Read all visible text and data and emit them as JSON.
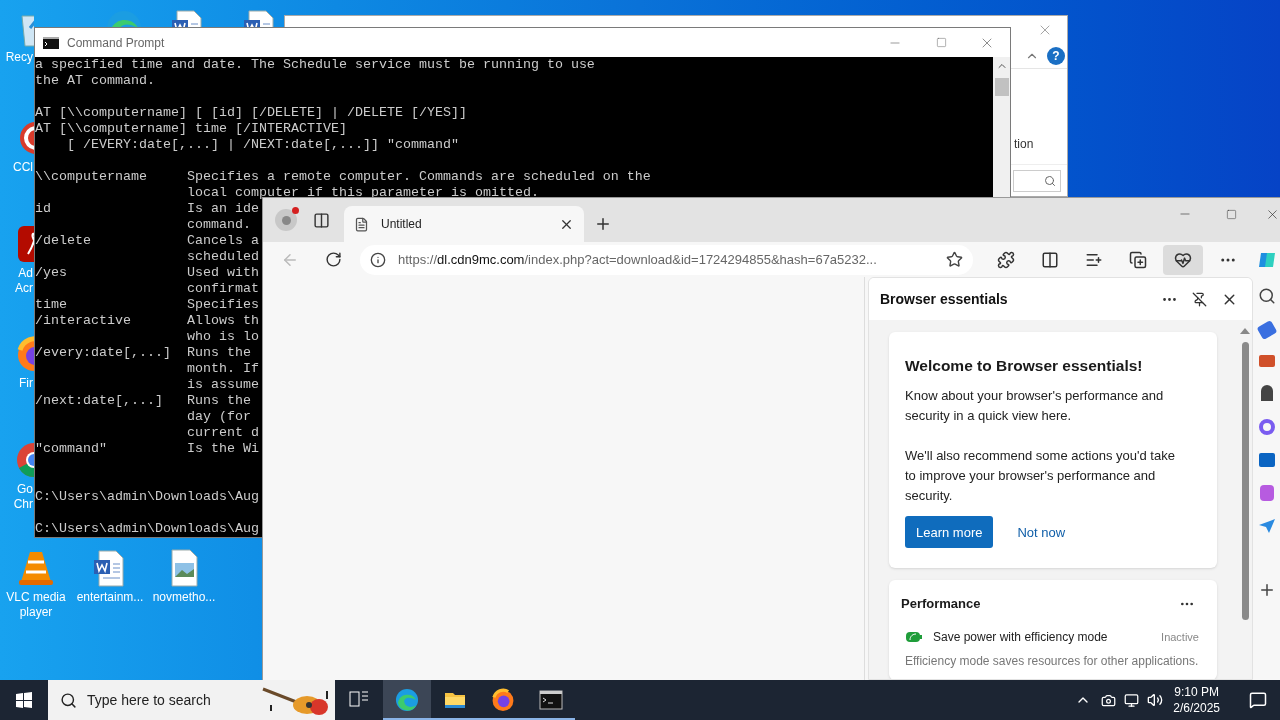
{
  "desktop_icons": [
    {
      "kind": "recycle",
      "lines": [
        "Recy"
      ]
    },
    {
      "kind": "edge"
    },
    {
      "kind": "word"
    },
    {
      "kind": "word"
    },
    {
      "kind": "ccleaner",
      "lines": [
        "CCl"
      ]
    },
    {
      "kind": "acrobat",
      "lines": [
        "Ad",
        "Acr"
      ]
    },
    {
      "kind": "firefox",
      "lines": [
        "Fir"
      ]
    },
    {
      "kind": "chrome",
      "lines": [
        "Go",
        "Chr"
      ]
    },
    {
      "kind": "vlc",
      "lines": [
        "VLC media",
        "player"
      ]
    },
    {
      "kind": "word",
      "lines": [
        "entertainm..."
      ]
    },
    {
      "kind": "image",
      "lines": [
        "novmetho..."
      ]
    }
  ],
  "explorer": {
    "fragments": [
      "tion"
    ],
    "help": "?"
  },
  "cmd": {
    "title": "Command Prompt",
    "blocks": [
      {
        "kind": "help",
        "lines": [
          "a specified time and date. The Schedule service must be running to use",
          "the AT command."
        ]
      },
      {
        "kind": "help",
        "lines": [
          "AT [\\\\computername] [ [id] [/DELETE] | /DELETE [/YES]]",
          "AT [\\\\computername] time [/INTERACTIVE]",
          "    [ /EVERY:date[,...] | /NEXT:date[,...]] \"command\""
        ]
      },
      {
        "kind": "help",
        "lines": [
          "\\\\computername     Specifies a remote computer. Commands are scheduled on the",
          "                   local computer if this parameter is omitted.",
          "id                 Is an ide",
          "                   command.",
          "/delete            Cancels a",
          "                   scheduled",
          "/yes               Used with",
          "                   confirmat",
          "time               Specifies",
          "/interactive       Allows th",
          "                   who is lo",
          "/every:date[,...]  Runs the",
          "                   month. If",
          "                   is assume",
          "/next:date[,...]   Runs the",
          "                   day (for",
          "                   current d",
          "\"command\"          Is the Wi"
        ]
      },
      {
        "kind": "prompt",
        "lines": [
          "C:\\Users\\admin\\Downloads\\Aug"
        ]
      },
      {
        "kind": "prompt",
        "lines": [
          "C:\\Users\\admin\\Downloads\\Aug"
        ]
      }
    ]
  },
  "browser": {
    "tabs": [
      {
        "title": "Untitled",
        "selected": true
      }
    ],
    "url": {
      "scheme": "https://",
      "host": "dl.cdn9mc.com",
      "path": "/index.php?act=download&id=1724294855&hash=67a5232..."
    },
    "panel": {
      "title": "Browser essentials",
      "welcome": {
        "heading": "Welcome to Browser essentials!",
        "paragraphs": [
          "Know about your browser's performance and security in a quick view here.",
          "We'll also recommend some actions you'd take to improve your browser's performance and security."
        ],
        "primary": "Learn more",
        "secondary": "Not now"
      },
      "performance": {
        "title": "Performance",
        "item": "Save power with efficiency mode",
        "status": "Inactive",
        "description": "Efficiency mode saves resources for other applications."
      }
    }
  },
  "taskbar": {
    "search_placeholder": "Type here to search",
    "apps": [
      {
        "kind": "taskview",
        "selected": false,
        "running": false
      },
      {
        "kind": "edge",
        "selected": true,
        "running": true
      },
      {
        "kind": "explorer",
        "selected": false,
        "running": true
      },
      {
        "kind": "firefox",
        "selected": false,
        "running": true
      },
      {
        "kind": "cmd",
        "selected": false,
        "running": true
      }
    ],
    "time": "9:10 PM",
    "date": "2/6/2025"
  }
}
